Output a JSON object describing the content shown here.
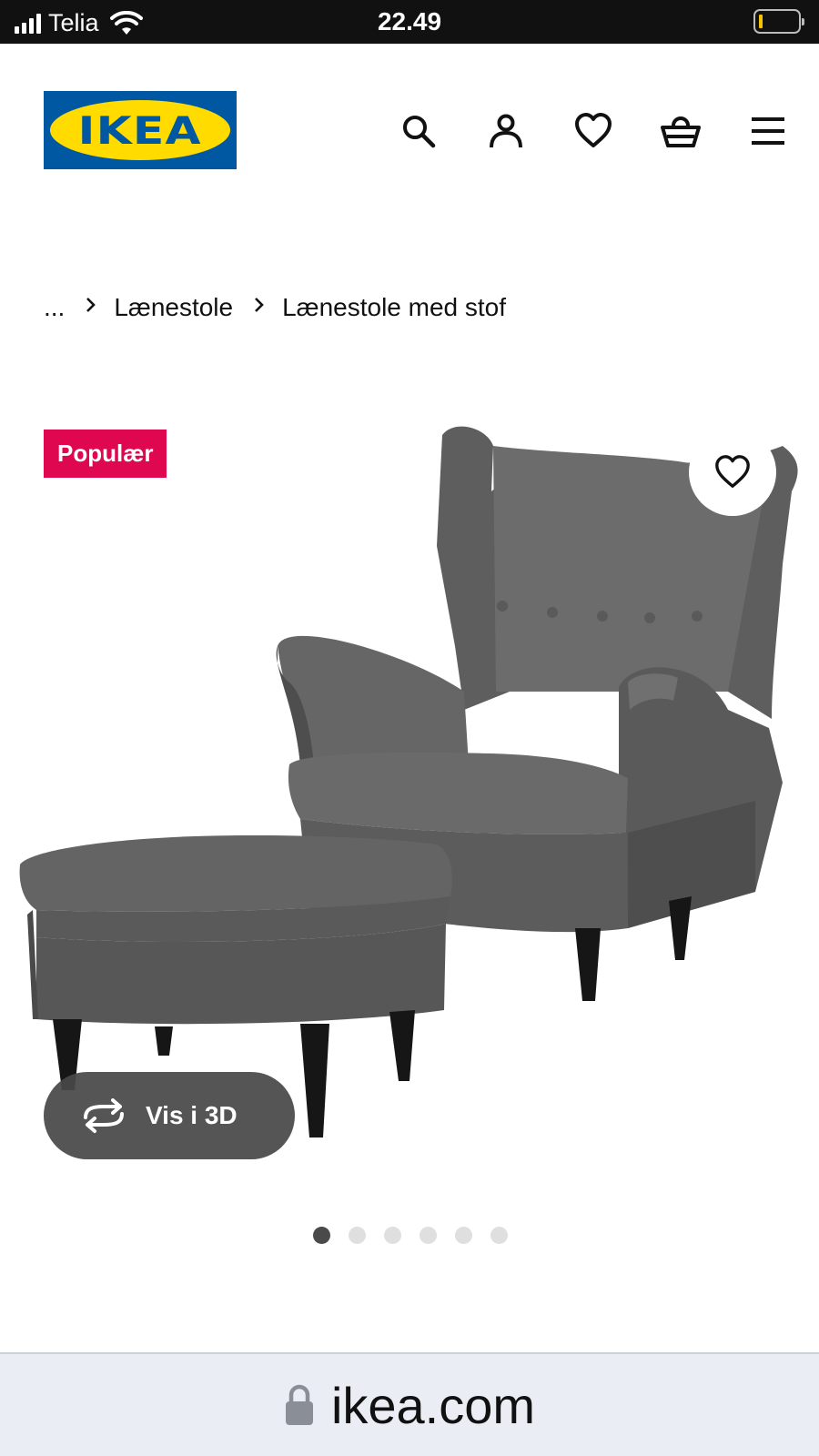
{
  "status_bar": {
    "carrier": "Telia",
    "time": "22.49",
    "signal_bars": 4,
    "battery_level": 0.05,
    "battery_color": "#f5c400"
  },
  "header": {
    "logo_text": "IKEA",
    "logo_registered": "®",
    "brand_colors": {
      "blue": "#0058a3",
      "yellow": "#ffdb00"
    },
    "icons": [
      "search-icon",
      "account-icon",
      "heart-icon",
      "basket-icon",
      "menu-icon"
    ]
  },
  "breadcrumb": {
    "items": [
      "...",
      "Lænestole",
      "Lænestole med stof"
    ]
  },
  "product": {
    "badge": "Populær",
    "badge_color": "#e00751",
    "view_3d_label": "Vis i 3D",
    "gallery_total_images": 6,
    "gallery_active_index": 0
  },
  "browser": {
    "url": "ikea.com"
  }
}
